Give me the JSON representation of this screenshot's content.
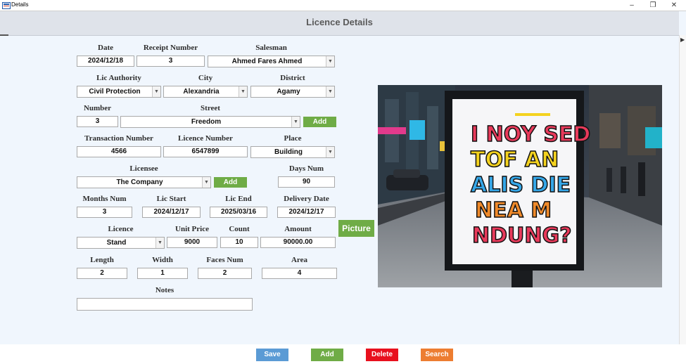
{
  "window": {
    "title": "Details",
    "minimize": "–",
    "restore": "❐",
    "close": "✕"
  },
  "header": {
    "title": "Licence Details"
  },
  "form": {
    "date": {
      "label": "Date",
      "value": "2024/12/18"
    },
    "receipt_number": {
      "label": "Receipt Number",
      "value": "3"
    },
    "salesman": {
      "label": "Salesman",
      "value": "Ahmed Fares Ahmed"
    },
    "lic_authority": {
      "label": "Lic Authority",
      "value": "Civil Protection"
    },
    "city": {
      "label": "City",
      "value": "Alexandria"
    },
    "district": {
      "label": "District",
      "value": "Agamy"
    },
    "number": {
      "label": "Number",
      "value": "3"
    },
    "street": {
      "label": "Street",
      "value": "Freedom",
      "add_label": "Add"
    },
    "transaction_number": {
      "label": "Transaction Number",
      "value": "4566"
    },
    "licence_number": {
      "label": "Licence Number",
      "value": "6547899"
    },
    "place": {
      "label": "Place",
      "value": "Building"
    },
    "licensee": {
      "label": "Licensee",
      "value": "The Company",
      "add_label": "Add"
    },
    "days_num": {
      "label": "Days Num",
      "value": "90"
    },
    "months_num": {
      "label": "Months Num",
      "value": "3"
    },
    "lic_start": {
      "label": "Lic Start",
      "value": "2024/12/17"
    },
    "lic_end": {
      "label": "Lic End",
      "value": "2025/03/16"
    },
    "delivery_date": {
      "label": "Delivery Date",
      "value": "2024/12/17"
    },
    "licence": {
      "label": "Licence",
      "value": "Stand"
    },
    "unit_price": {
      "label": "Unit Price",
      "value": "9000"
    },
    "count": {
      "label": "Count",
      "value": "10"
    },
    "amount": {
      "label": "Amount",
      "value": "90000.00"
    },
    "length": {
      "label": "Length",
      "value": "2"
    },
    "width": {
      "label": "Width",
      "value": "1"
    },
    "faces_num": {
      "label": "Faces Num",
      "value": "2"
    },
    "area": {
      "label": "Area",
      "value": "4"
    },
    "notes": {
      "label": "Notes",
      "value": ""
    }
  },
  "picture": {
    "button_label": "Picture",
    "poster_lines": [
      "I NOY SED",
      "TOF AN",
      "ALIS DIE",
      "NEA M",
      "NDUNG?"
    ]
  },
  "actions": {
    "save": "Save",
    "add": "Add",
    "delete": "Delete",
    "search": "Search"
  },
  "colors": {
    "accent_green": "#6fac46",
    "save_blue": "#5b9bd5",
    "add_green": "#6fac46",
    "delete_red": "#e8101e",
    "search_orange": "#ed7d31"
  },
  "icons": {
    "dropdown": "chevron-down-icon",
    "scroll": "arrow-right-icon"
  }
}
